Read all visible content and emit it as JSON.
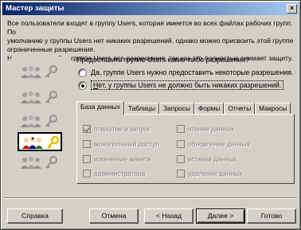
{
  "window": {
    "title": "Мастер защиты",
    "close_glyph": "×"
  },
  "intro": {
    "line1": "Все пользователи входят в группу Users, которая имеется во всех файлах рабочих групп. По",
    "line2": "умолчанию у группы Users нет никаких разрешений, однако можно присвоить этой группе",
    "line3": "ограниченные разрешения.",
    "line4": "Не предоставляйте группе Users все разрешения, так как это полностью снимает защиту."
  },
  "question": "Предоставить группе Users какие-либо разрешения?",
  "options": [
    {
      "accel": "Д",
      "rest": "а, группе Users нужно предоставить некоторые разрешения.",
      "checked": false
    },
    {
      "accel": "Н",
      "rest": "ет, у группы Users не должно быть никаких разрешений.",
      "checked": true
    }
  ],
  "tabs": [
    {
      "label": "База данных",
      "active": true
    },
    {
      "label": "Таблицы",
      "active": false
    },
    {
      "label": "Запросы",
      "active": false
    },
    {
      "label": "Формы",
      "active": false
    },
    {
      "label": "Отчеты",
      "active": false
    },
    {
      "label": "Макросы",
      "active": false
    }
  ],
  "permissions": {
    "left": [
      {
        "label": "открытие и запуск",
        "checked": true
      },
      {
        "label": "монопольный доступ",
        "checked": false
      },
      {
        "label": "изменение макета",
        "checked": false
      },
      {
        "label": "администратора",
        "checked": false
      }
    ],
    "right": [
      {
        "label": "чтение данных",
        "checked": false
      },
      {
        "label": "обновление данных",
        "checked": false
      },
      {
        "label": "вставка данных",
        "checked": false
      },
      {
        "label": "удаление данных",
        "checked": false
      }
    ]
  },
  "buttons": {
    "help": "Справка",
    "cancel": "Отмена",
    "back": "< Назад",
    "next": "Далее >",
    "finish": "Готово"
  },
  "icons": {
    "group": "users-group-icon",
    "key": "key-icon"
  }
}
